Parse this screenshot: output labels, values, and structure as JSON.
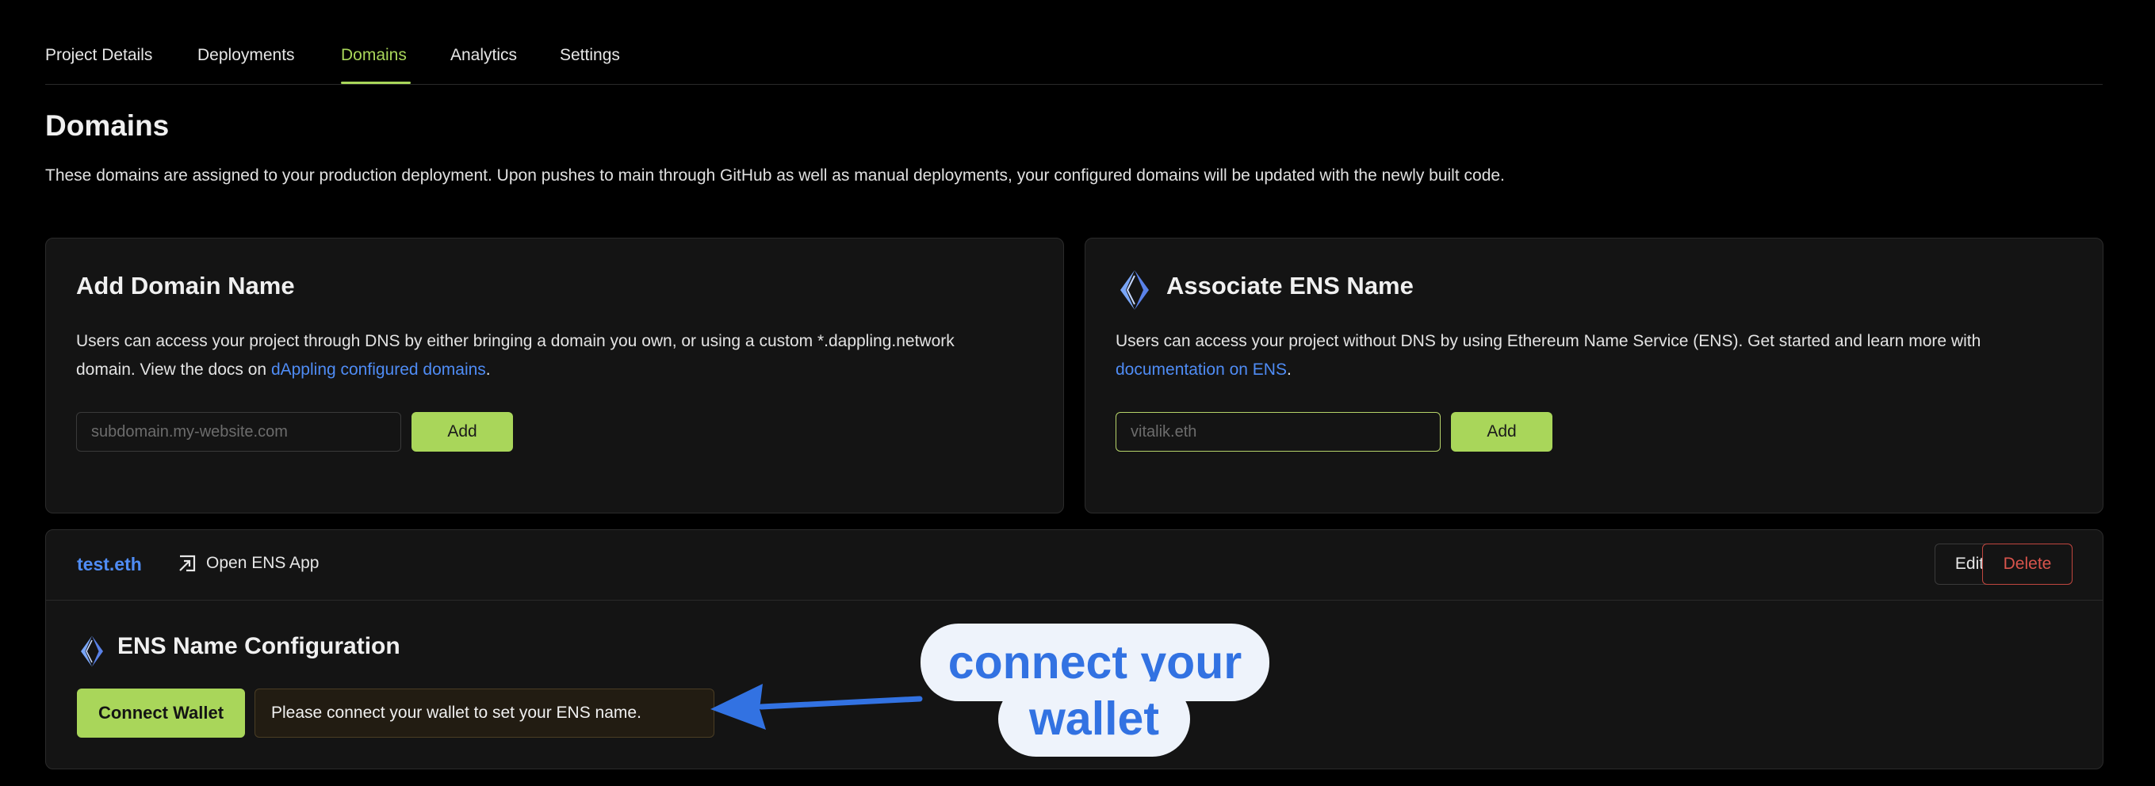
{
  "tabs": [
    "Project Details",
    "Deployments",
    "Domains",
    "Analytics",
    "Settings"
  ],
  "active_tab": "Domains",
  "page": {
    "title": "Domains",
    "description": "These domains are assigned to your production deployment. Upon pushes to main through GitHub as well as manual deployments, your configured domains will be updated with the newly built code."
  },
  "add_domain": {
    "title": "Add Domain Name",
    "text_line1": "Users can access your project through DNS by either bringing a domain you own, or using a custom *.dappling.network",
    "text_line2_prefix": "domain. View the docs on ",
    "docs_link": "dAppling configured domains",
    "text_line2_suffix": ".",
    "input_placeholder": "subdomain.my-website.com",
    "add_label": "Add"
  },
  "associate_ens": {
    "title": "Associate ENS Name",
    "text_line1": "Users can access your project without DNS by using Ethereum Name Service (ENS). Get started and learn more with",
    "docs_link": "documentation on ENS",
    "text_line2_suffix": ".",
    "input_placeholder": "vitalik.eth",
    "add_label": "Add"
  },
  "ens_entry": {
    "name": "test.eth",
    "open_app_label": "Open ENS App",
    "edit_label": "Edit",
    "delete_label": "Delete",
    "config_title": "ENS Name Configuration",
    "connect_label": "Connect Wallet",
    "notice": "Please connect your wallet to set your ENS name."
  },
  "annotation": {
    "line1": "connect your",
    "line2": "wallet",
    "color": "#3272e2"
  },
  "colors": {
    "accent": "#a9d65a",
    "link": "#4f8cf5",
    "danger": "#d8544c",
    "background": "#000000",
    "card": "#141414"
  }
}
